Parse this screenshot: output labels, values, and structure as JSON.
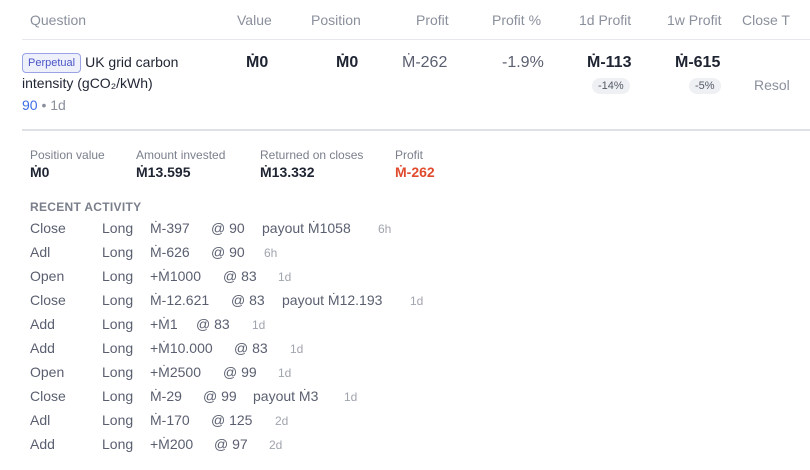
{
  "headers": {
    "question": "Question",
    "value": "Value",
    "position": "Position",
    "profit": "Profit",
    "profit_pct": "Profit %",
    "profit_1d": "1d Profit",
    "profit_1w": "1w Profit",
    "close": "Close T"
  },
  "market": {
    "badge": "Perpetual",
    "title": "UK grid carbon intensity (gCO₂/kWh)",
    "probability": "90",
    "separator": "•",
    "age": "1d",
    "value": "Ṁ0",
    "position": "Ṁ0",
    "profit": "Ṁ-262",
    "profit_pct": "-1.9%",
    "profit_1d": "Ṁ-113",
    "profit_1d_pct": "-14%",
    "profit_1w": "Ṁ-615",
    "profit_1w_pct": "-5%",
    "close": "Resol"
  },
  "summary": {
    "position_value_label": "Position value",
    "position_value": "Ṁ0",
    "amount_invested_label": "Amount invested",
    "amount_invested": "Ṁ13.595",
    "returned_label": "Returned on closes",
    "returned": "Ṁ13.332",
    "profit_label": "Profit",
    "profit": "Ṁ-262"
  },
  "recent": {
    "title": "RECENT ACTIVITY",
    "rows": [
      {
        "action": "Close",
        "dir": "Long",
        "amount": "Ṁ-397",
        "at": "@ 90",
        "payout": "payout Ṁ1058",
        "time": "6h"
      },
      {
        "action": "Adl",
        "dir": "Long",
        "amount": "Ṁ-626",
        "at": "@ 90",
        "payout": "",
        "time": "6h"
      },
      {
        "action": "Open",
        "dir": "Long",
        "amount": "+Ṁ1000",
        "at": "@ 83",
        "payout": "",
        "time": "1d"
      },
      {
        "action": "Close",
        "dir": "Long",
        "amount": "Ṁ-12.621",
        "at": "@ 83",
        "payout": "payout Ṁ12.193",
        "time": "1d"
      },
      {
        "action": "Add",
        "dir": "Long",
        "amount": "+Ṁ1",
        "at": "@ 83",
        "payout": "",
        "time": "1d"
      },
      {
        "action": "Add",
        "dir": "Long",
        "amount": "+Ṁ10.000",
        "at": "@ 83",
        "payout": "",
        "time": "1d"
      },
      {
        "action": "Open",
        "dir": "Long",
        "amount": "+Ṁ2500",
        "at": "@ 99",
        "payout": "",
        "time": "1d"
      },
      {
        "action": "Close",
        "dir": "Long",
        "amount": "Ṁ-29",
        "at": "@ 99",
        "payout": "payout Ṁ3",
        "time": "1d"
      },
      {
        "action": "Adl",
        "dir": "Long",
        "amount": "Ṁ-170",
        "at": "@ 125",
        "payout": "",
        "time": "2d"
      },
      {
        "action": "Add",
        "dir": "Long",
        "amount": "+Ṁ200",
        "at": "@ 97",
        "payout": "",
        "time": "2d"
      }
    ]
  }
}
